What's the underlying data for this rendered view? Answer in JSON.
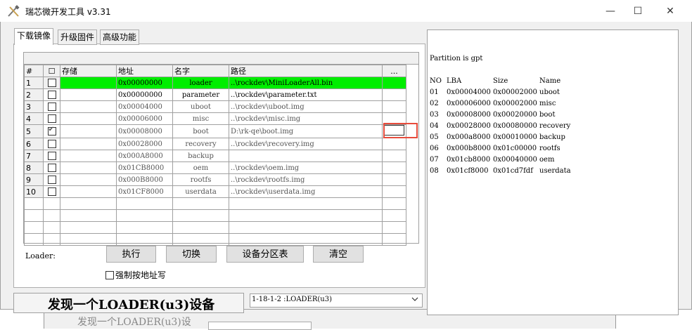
{
  "window": {
    "title": "瑞芯微开发工具 v3.31",
    "controls": {
      "minimize": "—",
      "maximize": "☐",
      "close": "✕"
    }
  },
  "background_window": {
    "text": "发现一个LOADER(u3)设"
  },
  "tabs": [
    {
      "label": "下载镜像",
      "active": true
    },
    {
      "label": "升级固件",
      "active": false
    },
    {
      "label": "高级功能",
      "active": false
    }
  ],
  "table": {
    "headers": {
      "num": "#",
      "check": "☐",
      "storage": "存储",
      "address": "地址",
      "name": "名字",
      "path": "路径",
      "browse": "..."
    },
    "rows": [
      {
        "num": "1",
        "checked": false,
        "address": "0x00000000",
        "name": "loader",
        "path": "..\\rockdev\\MiniLoaderAll.bin",
        "highlight": true
      },
      {
        "num": "2",
        "checked": false,
        "address": "0x00000000",
        "name": "parameter",
        "path": "..\\rockdev\\parameter.txt",
        "highlight": false
      },
      {
        "num": "3",
        "checked": false,
        "address": "0x00004000",
        "name": "uboot",
        "path": "..\\rockdev\\uboot.img",
        "highlight": false
      },
      {
        "num": "4",
        "checked": false,
        "address": "0x00006000",
        "name": "misc",
        "path": "..\\rockdev\\misc.img",
        "highlight": false
      },
      {
        "num": "5",
        "checked": true,
        "address": "0x00008000",
        "name": "boot",
        "path": "D:\\rk-qe\\boot.img",
        "highlight": false
      },
      {
        "num": "6",
        "checked": false,
        "address": "0x00028000",
        "name": "recovery",
        "path": "..\\rockdev\\recovery.img",
        "highlight": false
      },
      {
        "num": "7",
        "checked": false,
        "address": "0x000A8000",
        "name": "backup",
        "path": "",
        "highlight": false
      },
      {
        "num": "8",
        "checked": false,
        "address": "0x01CB8000",
        "name": "oem",
        "path": "..\\rockdev\\oem.img",
        "highlight": false
      },
      {
        "num": "9",
        "checked": false,
        "address": "0x000B8000",
        "name": "rootfs",
        "path": "..\\rockdev\\rootfs.img",
        "highlight": false
      },
      {
        "num": "10",
        "checked": false,
        "address": "0x01CF8000",
        "name": "userdata",
        "path": "..\\rockdev\\userdata.img",
        "highlight": false
      }
    ]
  },
  "controls": {
    "loader_label": "Loader:",
    "run_button": "执行",
    "switch_button": "切换",
    "partition_button": "设备分区表",
    "clear_button": "清空",
    "force_address_label": "强制按地址写"
  },
  "status": {
    "message": "发现一个LOADER(u3)设备",
    "device_select": "1-18-1-2 :LOADER(u3)"
  },
  "partition_log": {
    "header": "Partition is gpt",
    "columns": [
      "NO",
      "LBA",
      "Size",
      "Name"
    ],
    "rows": [
      [
        "01",
        "0x00004000",
        "0x00002000",
        "uboot"
      ],
      [
        "02",
        "0x00006000",
        "0x00002000",
        "misc"
      ],
      [
        "03",
        "0x00008000",
        "0x00020000",
        "boot"
      ],
      [
        "04",
        "0x00028000",
        "0x00080000",
        "recovery"
      ],
      [
        "05",
        "0x000a8000",
        "0x00010000",
        "backup"
      ],
      [
        "06",
        "0x000b8000",
        "0x01c00000",
        "rootfs"
      ],
      [
        "07",
        "0x01cb8000",
        "0x00040000",
        "oem"
      ],
      [
        "08",
        "0x01cf8000",
        "0x01cd7fdf",
        "userdata"
      ]
    ]
  },
  "colors": {
    "highlight_row": "#00ee00",
    "annotation_box": "#e74c3c"
  }
}
